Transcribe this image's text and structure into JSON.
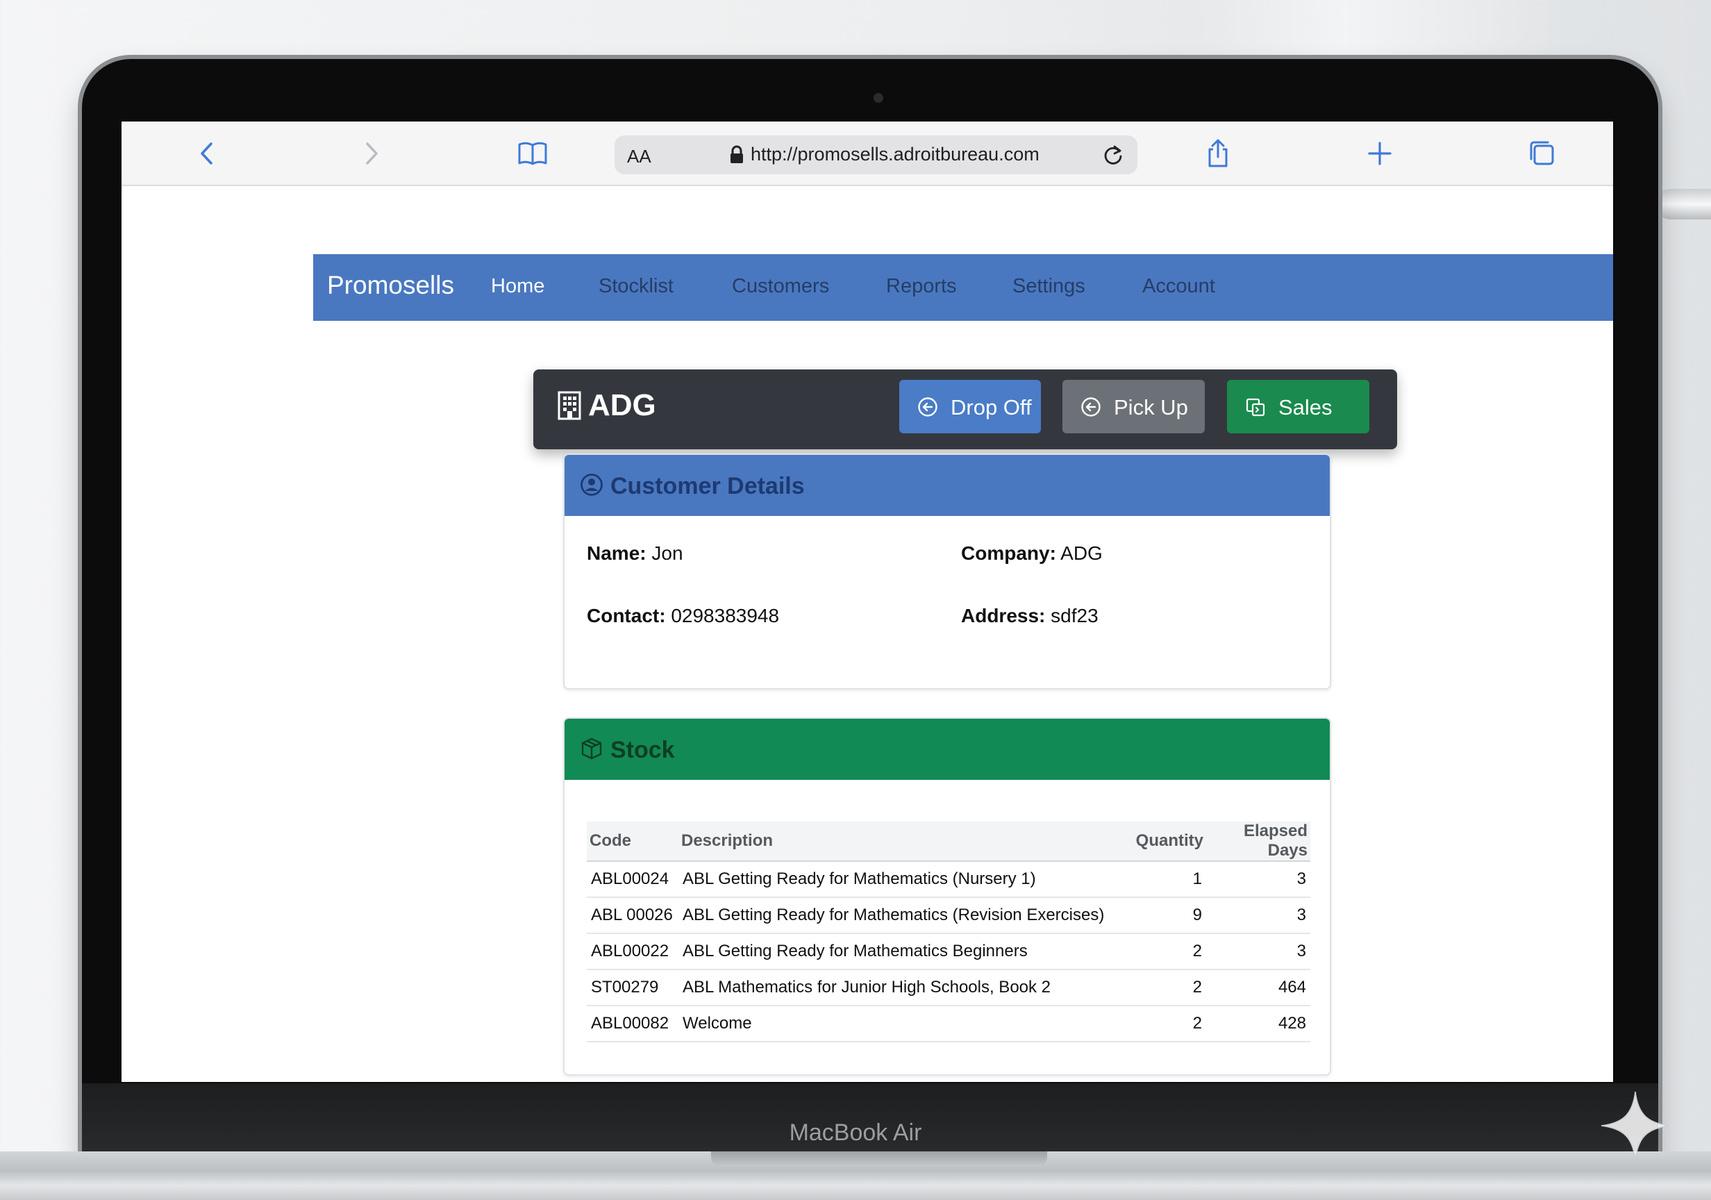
{
  "browser": {
    "text_size_label": "AA",
    "url": "http://promosells.adroitbureau.com"
  },
  "app": {
    "brand": "Promosells",
    "nav": [
      {
        "label": "Home",
        "active": true
      },
      {
        "label": "Stocklist"
      },
      {
        "label": "Customers"
      },
      {
        "label": "Reports"
      },
      {
        "label": "Settings"
      },
      {
        "label": "Account"
      }
    ]
  },
  "header": {
    "title": "ADG",
    "buttons": {
      "drop_off": "Drop Off",
      "pick_up": "Pick Up",
      "sales": "Sales"
    }
  },
  "customer": {
    "section_title": "Customer Details",
    "name_label": "Name:",
    "name": "Jon",
    "company_label": "Company:",
    "company": "ADG",
    "contact_label": "Contact:",
    "contact": "0298383948",
    "address_label": "Address:",
    "address": "sdf23"
  },
  "stock": {
    "section_title": "Stock",
    "columns": [
      "Code",
      "Description",
      "Quantity",
      "Elapsed Days"
    ],
    "rows": [
      {
        "code": "ABL00024",
        "description": "ABL Getting Ready for Mathematics (Nursery 1)",
        "quantity": "1",
        "elapsed_days": "3"
      },
      {
        "code": "ABL 00026",
        "description": "ABL Getting Ready for Mathematics (Revision Exercises)",
        "quantity": "9",
        "elapsed_days": "3"
      },
      {
        "code": "ABL00022",
        "description": "ABL Getting Ready for Mathematics Beginners",
        "quantity": "2",
        "elapsed_days": "3"
      },
      {
        "code": "ST00279",
        "description": "ABL Mathematics for Junior High Schools, Book 2",
        "quantity": "2",
        "elapsed_days": "464"
      },
      {
        "code": "ABL00082",
        "description": "Welcome",
        "quantity": "2",
        "elapsed_days": "428"
      }
    ]
  },
  "device": {
    "label": "MacBook Air"
  },
  "colors": {
    "nav_blue": "#4a78c0",
    "header_dark": "#34383e",
    "drop_off_blue": "#4a7cc7",
    "pick_up_gray": "#6c7177",
    "sales_green": "#1a8a4e",
    "stock_green": "#118a55"
  },
  "icons": {
    "browser": [
      "back-icon",
      "forward-icon",
      "bookmarks-icon",
      "lock-icon",
      "reload-icon",
      "share-icon",
      "new-tab-icon",
      "tabs-icon"
    ],
    "header": "building-icon",
    "drop_off": "arrow-circle-left-icon",
    "pick_up": "arrow-circle-left-icon",
    "sales": "cart-icon",
    "customer": "user-circle-icon",
    "stock": "box-icon"
  }
}
